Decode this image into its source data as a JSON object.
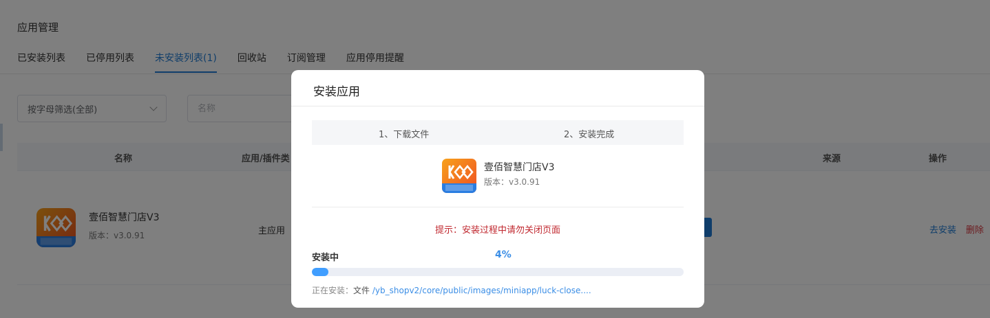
{
  "page": {
    "title": "应用管理",
    "tabs": [
      {
        "label": "已安装列表",
        "active": false
      },
      {
        "label": "已停用列表",
        "active": false
      },
      {
        "label": "未安装列表(1)",
        "active": true
      },
      {
        "label": "回收站",
        "active": false
      },
      {
        "label": "订阅管理",
        "active": false
      },
      {
        "label": "应用停用提醒",
        "active": false
      }
    ],
    "filter": {
      "selected": "按字母筛选(全部)"
    },
    "search": {
      "placeholder": "名称"
    },
    "table": {
      "headers": {
        "name": "名称",
        "type": "应用/插件类",
        "source": "来源",
        "actions": "操作"
      },
      "rows": [
        {
          "name": "壹佰智慧门店V3",
          "version": "版本：v3.0.91",
          "type": "主应用",
          "actions": {
            "install": "去安装",
            "delete": "删除"
          }
        }
      ]
    }
  },
  "modal": {
    "title": "安装应用",
    "steps": [
      "1、下载文件",
      "2、安装完成"
    ],
    "app": {
      "name": "壹佰智慧门店V3",
      "version": "版本：v3.0.91"
    },
    "tip": "提示：安装过程中请勿关闭页面",
    "status": "安装中",
    "percent_text": "4%",
    "progress": 0.04,
    "current_file": {
      "label": "正在安装：",
      "kind": "文件",
      "path": "/yb_shopv2/core/public/images/miniapp/luck-close...."
    }
  },
  "colors": {
    "accent": "#1f7bd4",
    "danger": "#d9363e",
    "progress": "#409eff",
    "icon_orange": "#f26b1d",
    "icon_blue": "#2a7de1"
  },
  "icons": {
    "app_logo": "smart-store-logo-icon",
    "dropdown": "chevron-down-icon"
  }
}
